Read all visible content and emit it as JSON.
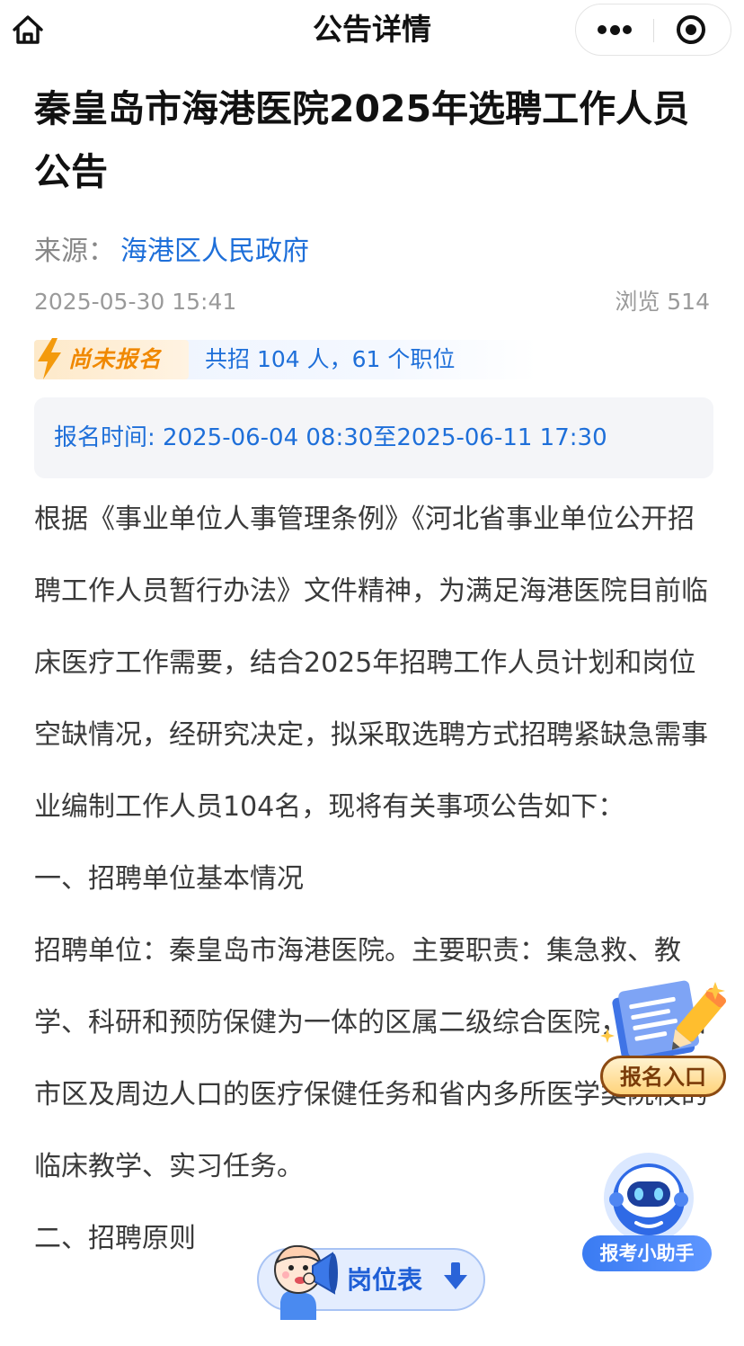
{
  "nav": {
    "title": "公告详情",
    "home_icon": "home-icon",
    "more_icon": "more-dots-icon",
    "close_icon": "target-close-icon"
  },
  "article": {
    "title": "秦皇岛市海港医院2025年选聘工作人员公告",
    "source_label": "来源：",
    "source_name": "海港区人民政府",
    "date": "2025-05-30 15:41",
    "views": "浏览 514",
    "status_badge": "尚未报名",
    "recruit_summary": "共招 104 人，61 个职位",
    "registration_time": "报名时间: 2025-06-04 08:30至2025-06-11 17:30",
    "paragraphs": [
      "根据《事业单位人事管理条例》《河北省事业单位公开招聘工作人员暂行办法》文件精神，为满足海港医院目前临床医疗工作需要，结合2025年招聘工作人员计划和岗位空缺情况，经研究决定，拟采取选聘方式招聘紧缺急需事业编制工作人员104名，现将有关事项公告如下：",
      "一、招聘单位基本情况",
      "招聘单位：秦皇岛市海港医院。主要职责：集急救、教学、科研和预防保健为一体的区属二级综合医院，担负着市区及周边人口的医疗保健任务和省内多所医学类院校的临床教学、实习任务。",
      "二、招聘原则"
    ]
  },
  "floating": {
    "signup_label": "报名入口",
    "helper_label": "报考小助手",
    "posts_label": "岗位表"
  },
  "colors": {
    "accent_blue": "#1e6fd9",
    "badge_orange": "#f08800",
    "title_text": "#111111",
    "meta_gray": "#9a9a9a"
  }
}
